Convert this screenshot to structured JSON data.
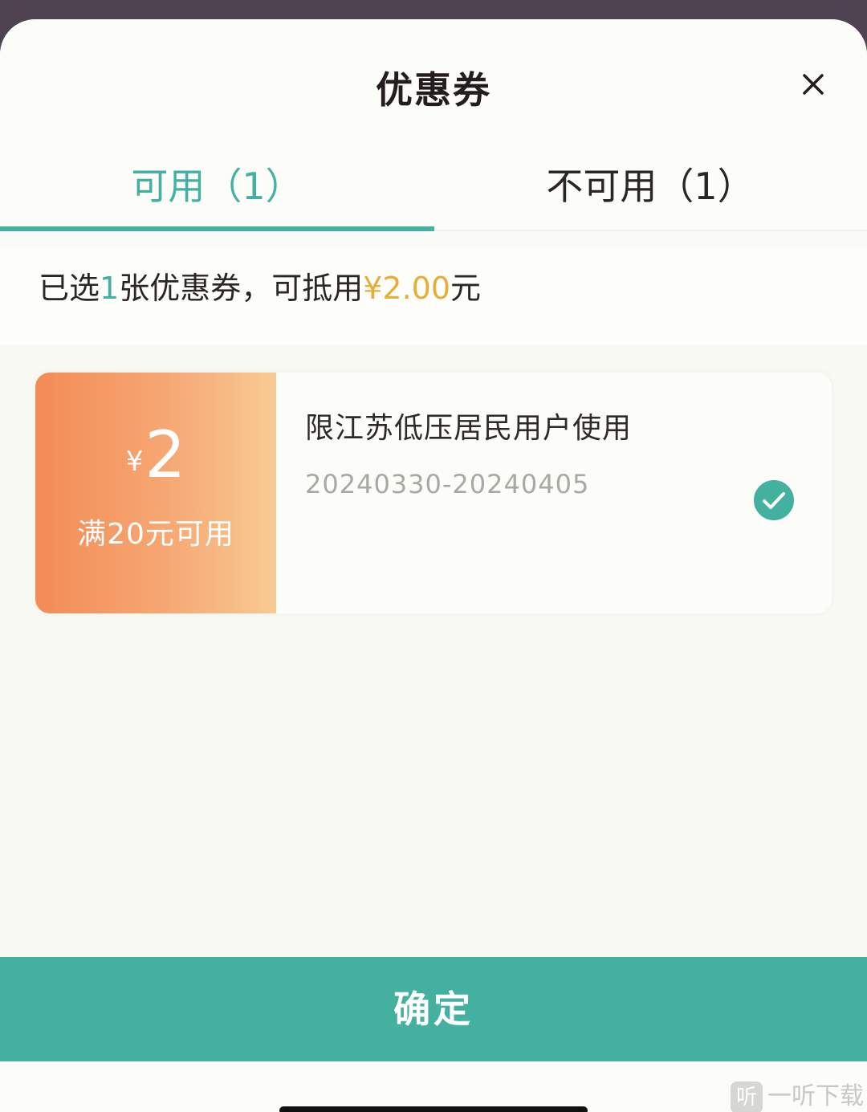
{
  "sheet": {
    "title": "优惠券"
  },
  "tabs": [
    {
      "label": "可用（1）",
      "active": true
    },
    {
      "label": "不可用（1）",
      "active": false
    }
  ],
  "summary": {
    "prefix": "已选",
    "count": "1",
    "middle": "张优惠券，可抵用",
    "amount": "¥2.00",
    "suffix": "元"
  },
  "coupons": [
    {
      "currency": "¥",
      "amount": "2",
      "threshold": "满20元可用",
      "description": "限江苏低压居民用户使用",
      "valid_period": "20240330-20240405",
      "selected": true
    }
  ],
  "confirm_label": "确定",
  "watermark": {
    "logo_text": "听",
    "text": "一听下载"
  },
  "colors": {
    "accent": "#43b0a0",
    "highlight": "#e8ad36",
    "coupon_gradient_start": "#f38b55",
    "coupon_gradient_end": "#f8ca93"
  }
}
